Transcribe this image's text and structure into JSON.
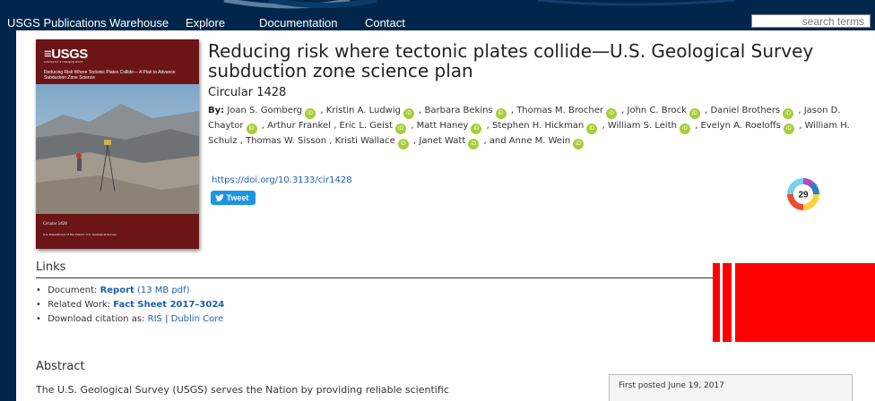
{
  "nav": {
    "brand": "USGS Publications Warehouse",
    "items": [
      "Explore",
      "Documentation",
      "Contact"
    ],
    "search_placeholder": "search terms"
  },
  "cover": {
    "logo": "≡USGS",
    "logo_sub": "science for a changing world",
    "title": "Reducing Risk Where Tectonic Plates Collide— A Plan to Advance Subduction Zone Science",
    "circular": "Circular 1428",
    "dept": "U.S. Department of the Interior U.S. Geological Survey"
  },
  "publication": {
    "title": "Reducing risk where tectonic plates collide—U.S. Geological Survey subduction zone science plan",
    "series": "Circular 1428",
    "by_label": "By:",
    "authors": [
      "Joan S. Gomberg",
      "Kristin A. Ludwig",
      "Barbara Bekins",
      "Thomas M. Brocher",
      "John C. Brock",
      "Daniel Brothers",
      "Jason D. Chaytor",
      "Arthur Frankel",
      "Eric L. Geist",
      "Matt Haney",
      "Stephen H. Hickman",
      "William S. Leith",
      "Evelyn A. Roeloffs",
      "William H. Schulz",
      "Thomas W. Sisson",
      "Kristi Wallace",
      "Janet Watt",
      "Anne M. Wein"
    ],
    "doi": "https://doi.org/10.3133/cir1428",
    "tweet_label": "Tweet",
    "altmetric_score": "29",
    "orcid_icon": "iD"
  },
  "links": {
    "heading": "Links",
    "document_label": "Document:",
    "document_link": "Report",
    "document_size": "(13 MB pdf)",
    "related_label": "Related Work:",
    "related_link": "Fact Sheet 2017–3024",
    "citation_label": "Download citation as:",
    "citation_ris": "RIS",
    "citation_sep": "|",
    "citation_dc": "Dublin Core"
  },
  "abstract": {
    "heading": "Abstract",
    "text": "The U.S. Geological Survey (USGS) serves the Nation by providing reliable scientific"
  },
  "sidebar": {
    "posted": "First posted June 19, 2017"
  },
  "colors": {
    "nav_bg": "#00264c",
    "link": "#1e5fae",
    "orcid": "#a6ce39",
    "tweet": "#1b95e0",
    "red_block": "#ff0000"
  }
}
